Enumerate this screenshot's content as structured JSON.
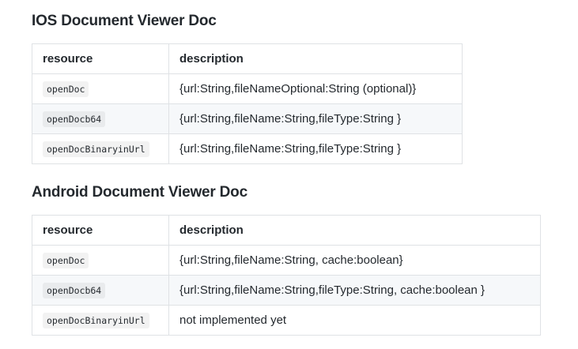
{
  "ios": {
    "heading": "IOS Document Viewer Doc",
    "headers": [
      "resource",
      "description"
    ],
    "rows": [
      {
        "resource": "openDoc",
        "description": "{url:String,fileNameOptional:String (optional)}"
      },
      {
        "resource": "openDocb64",
        "description": "{url:String,fileName:String,fileType:String }"
      },
      {
        "resource": "openDocBinaryinUrl",
        "description": "{url:String,fileName:String,fileType:String }"
      }
    ]
  },
  "android": {
    "heading": "Android Document Viewer Doc",
    "headers": [
      "resource",
      "description"
    ],
    "rows": [
      {
        "resource": "openDoc",
        "description": "{url:String,fileName:String, cache:boolean}"
      },
      {
        "resource": "openDocb64",
        "description": "{url:String,fileName:String,fileType:String, cache:boolean }"
      },
      {
        "resource": "openDocBinaryinUrl",
        "description": "not implemented yet"
      }
    ]
  }
}
